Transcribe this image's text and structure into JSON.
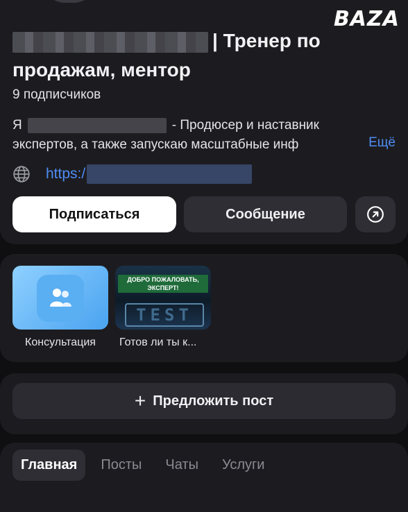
{
  "watermark": "BAZA",
  "profile": {
    "name_suffix": "| Тренер по продажам, ментор",
    "subscribers": "9 подписчиков",
    "bio_prefix": "Я",
    "bio_line1_rest": "- Продюсер и наставник",
    "bio_line2": "экспертов, а также запускаю масштабные инф",
    "more_label": "Ещё",
    "link_prefix": "https:/"
  },
  "actions": {
    "subscribe_label": "Подписаться",
    "message_label": "Сообщение",
    "share_icon": "arrow-up-right-circle-icon"
  },
  "services": [
    {
      "label": "Консультация",
      "icon": "people-icon"
    },
    {
      "label": "Готов ли ты к...",
      "banner": "ДОБРО ПОЖАЛОВАТЬ, ЭКСПЕРТ!",
      "thumb_text": "TEST"
    }
  ],
  "suggest_post": {
    "label": "Предложить пост",
    "icon": "plus-icon"
  },
  "tabs": [
    {
      "label": "Главная",
      "active": true
    },
    {
      "label": "Посты",
      "active": false
    },
    {
      "label": "Чаты",
      "active": false
    },
    {
      "label": "Услуги",
      "active": false
    }
  ],
  "colors": {
    "link": "#4f8cf5",
    "background": "#0f0f12",
    "card": "#1c1c20",
    "button_dark": "#2e2e34"
  }
}
